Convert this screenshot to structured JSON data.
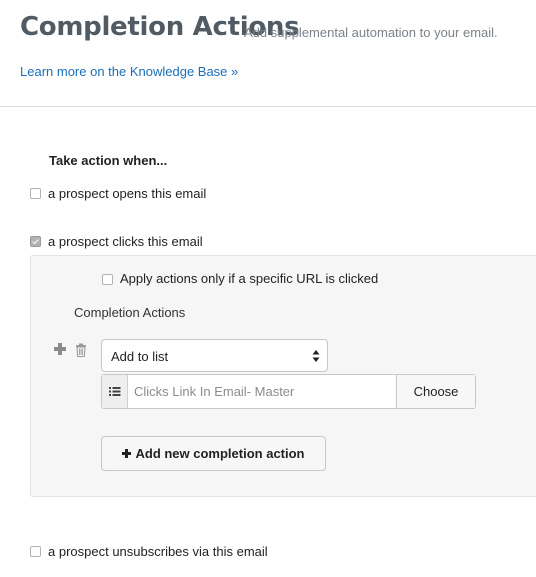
{
  "header": {
    "title": "Completion Actions",
    "subtitle": "Add supplemental automation to your email.",
    "kb_link": "Learn more on the Knowledge Base »"
  },
  "trigger": {
    "heading": "Take action when...",
    "opens": {
      "label": "a prospect opens this email",
      "checked": false
    },
    "clicks": {
      "label": "a prospect clicks this email",
      "checked": true
    },
    "unsubscribes": {
      "label": "a prospect unsubscribes via this email",
      "checked": false
    }
  },
  "panel": {
    "specific_url": {
      "label": "Apply actions only if a specific URL is clicked",
      "checked": false
    },
    "completion_label": "Completion Actions",
    "action_select": {
      "value": "Add to list"
    },
    "list_field": {
      "placeholder": "Clicks Link In Email- Master",
      "choose_label": "Choose"
    },
    "add_button_label": "Add new completion action"
  },
  "icons": {
    "plus": "plus-icon",
    "trash": "trash-icon",
    "select_arrows": "sort-arrows-icon",
    "list": "list-icon",
    "add_plus": "plus-icon"
  },
  "colors": {
    "title": "#515b64",
    "link": "#1a6fb8",
    "panel_bg": "#f6f6f6",
    "divider": "#dcdcdc"
  }
}
